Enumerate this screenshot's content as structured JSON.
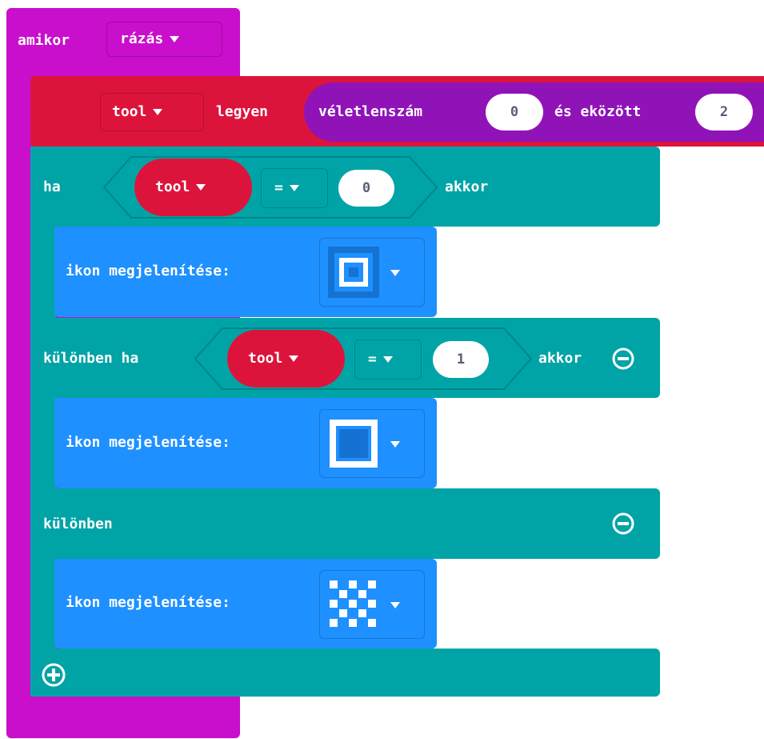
{
  "colors": {
    "event": "#c90fcb",
    "variables": "#dc143c",
    "math": "#9013b8",
    "logic": "#00a4a6",
    "basic": "#1e90ff",
    "white": "#ffffff",
    "number_text": "#575e75"
  },
  "event_block": {
    "label": "amikor",
    "gesture": "rázás"
  },
  "set_block": {
    "variable": "tool",
    "label": "legyen",
    "random": {
      "label": "véletlenszám",
      "from": "0",
      "and_label": "és eközött",
      "to": "2"
    }
  },
  "if_block": {
    "if_label": "ha",
    "then_label": "akkor",
    "elseif_label": "különben ha",
    "else_label": "különben",
    "condition1": {
      "variable": "tool",
      "operator": "=",
      "value": "0"
    },
    "condition2": {
      "variable": "tool",
      "operator": "=",
      "value": "1"
    },
    "minus_icon": "minus-circle-icon",
    "plus_icon": "plus-circle-icon"
  },
  "show_icon_blocks": [
    {
      "label": "ikon megjelenítése:",
      "icon": "square-small-led-icon"
    },
    {
      "label": "ikon megjelenítése:",
      "icon": "square-large-led-icon"
    },
    {
      "label": "ikon megjelenítése:",
      "icon": "chessboard-led-icon"
    }
  ]
}
